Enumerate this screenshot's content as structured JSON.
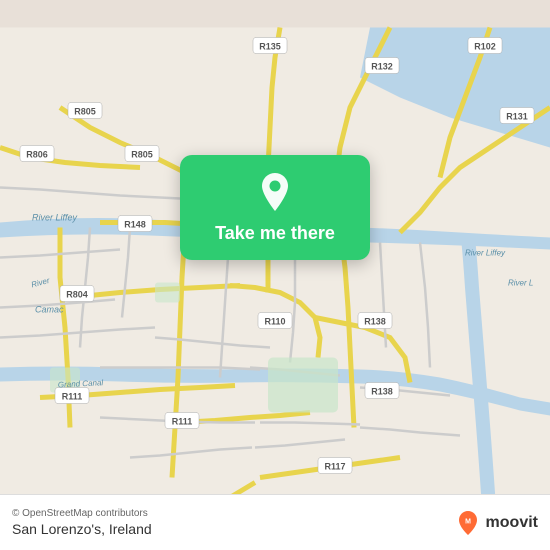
{
  "map": {
    "alt": "Map of Dublin, Ireland",
    "background_color": "#e8e0d8"
  },
  "cta": {
    "button_label": "Take me there",
    "pin_icon": "location-pin"
  },
  "bottom_bar": {
    "copyright": "© OpenStreetMap contributors",
    "location": "San Lorenzo's, Ireland",
    "moovit_label": "moovit"
  }
}
